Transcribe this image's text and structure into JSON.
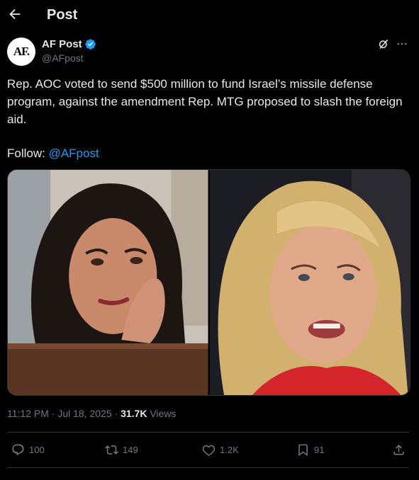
{
  "header": {
    "title": "Post"
  },
  "author": {
    "avatar_text": "AF.",
    "name": "AF Post",
    "handle": "@AFpost"
  },
  "tweet": {
    "text": "Rep. AOC voted to send $500 million to fund Israel’s missile defense program, against the amendment Rep. MTG proposed to slash the foreign aid.",
    "follow_label": "Follow: ",
    "follow_link": "@AFpost"
  },
  "meta": {
    "time": "11:12 PM",
    "date": "Jul 18, 2025",
    "views_count": "31.7K",
    "views_label": " Views"
  },
  "actions": {
    "replies": "100",
    "reposts": "149",
    "likes": "1.2K",
    "bookmarks": "91"
  },
  "colors": {
    "background": "#000000",
    "accent": "#1d9bf0",
    "muted": "#71767b",
    "text": "#e7e9ea",
    "divider": "#2f3336"
  },
  "icons": [
    "back-arrow-icon",
    "verified-badge-icon",
    "grok-icon",
    "more-icon",
    "reply-icon",
    "repost-icon",
    "like-icon",
    "bookmark-icon",
    "share-icon"
  ]
}
